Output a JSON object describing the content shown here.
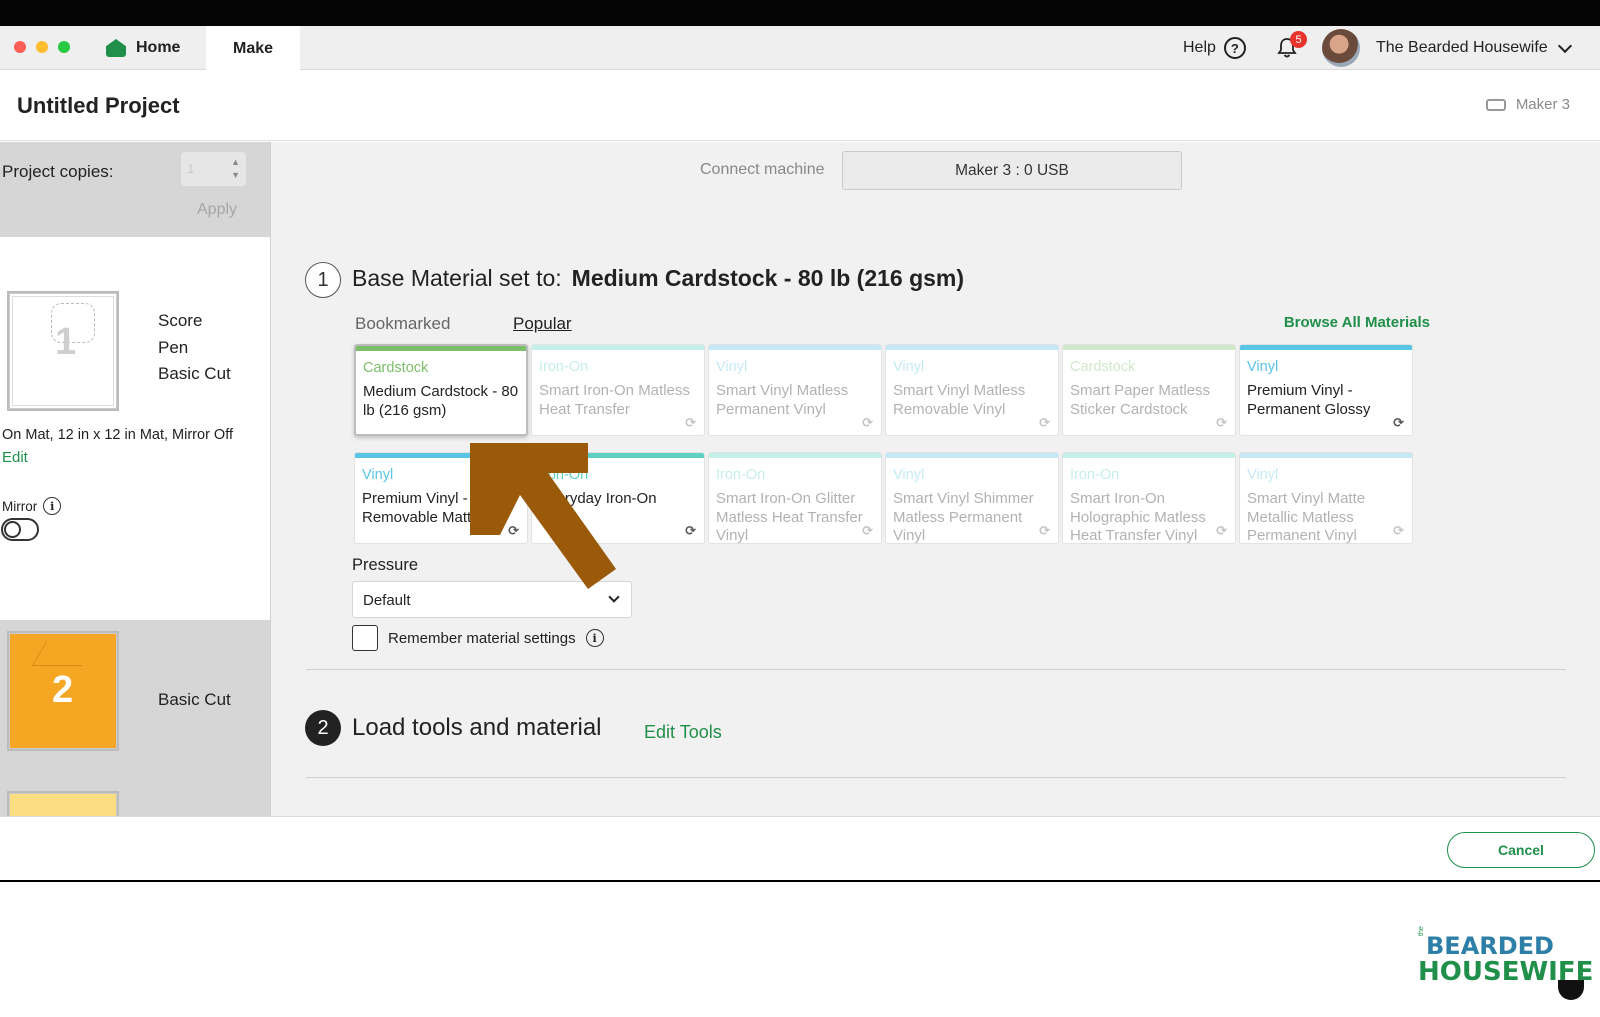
{
  "titlebar": {
    "home_label": "Home",
    "make_label": "Make",
    "help_label": "Help",
    "help_icon": "?",
    "notification_count": "5",
    "user_name": "The Bearded Housewife"
  },
  "project": {
    "title": "Untitled Project",
    "machine": "Maker 3"
  },
  "sidebar": {
    "copies_label": "Project copies:",
    "copies_value": "1",
    "apply_label": "Apply",
    "mat1": {
      "number": "1",
      "operations": [
        "Score",
        "Pen",
        "Basic Cut"
      ],
      "settings": "On Mat, 12 in x 12 in Mat, Mirror Off",
      "edit_label": "Edit",
      "mirror_label": "Mirror"
    },
    "mat2": {
      "number": "2",
      "operation": "Basic Cut"
    }
  },
  "connect": {
    "label": "Connect machine",
    "button": "Maker 3 : 0 USB"
  },
  "step1": {
    "number": "1",
    "prefix": "Base Material set to:",
    "material": "Medium Cardstock - 80 lb (216 gsm)",
    "tabs": [
      "Bookmarked",
      "Popular"
    ],
    "browse_label": "Browse All Materials",
    "cards": [
      {
        "category": "Cardstock",
        "name": "Medium Cardstock - 80 lb (216 gsm)",
        "color": "#7cbf6a",
        "faded": false,
        "selected": true
      },
      {
        "category": "Iron-On",
        "name": "Smart Iron-On Matless Heat Transfer",
        "color": "#5fd1c4",
        "faded": true
      },
      {
        "category": "Vinyl",
        "name": "Smart Vinyl Matless Permanent Vinyl",
        "color": "#58c4e6",
        "faded": true
      },
      {
        "category": "Vinyl",
        "name": "Smart Vinyl Matless Removable Vinyl",
        "color": "#58c4e6",
        "faded": true
      },
      {
        "category": "Cardstock",
        "name": "Smart Paper Matless Sticker Cardstock",
        "color": "#7cbf6a",
        "faded": true
      },
      {
        "category": "Vinyl",
        "name": "Premium Vinyl - Permanent Glossy",
        "color": "#58c4e6",
        "faded": false
      },
      {
        "category": "Vinyl",
        "name": "Premium Vinyl - Removable Matte",
        "color": "#58c4e6",
        "faded": false
      },
      {
        "category": "Iron-On",
        "name": "Everyday Iron-On",
        "color": "#5fd1c4",
        "faded": false
      },
      {
        "category": "Iron-On",
        "name": "Smart Iron-On Glitter Matless Heat Transfer Vinyl",
        "color": "#5fd1c4",
        "faded": true
      },
      {
        "category": "Vinyl",
        "name": "Smart Vinyl Shimmer Matless Permanent Vinyl",
        "color": "#58c4e6",
        "faded": true
      },
      {
        "category": "Iron-On",
        "name": "Smart Iron-On Holographic Matless Heat Transfer Vinyl",
        "color": "#5fd1c4",
        "faded": true
      },
      {
        "category": "Vinyl",
        "name": "Smart Vinyl Matte Metallic Matless Permanent Vinyl",
        "color": "#58c4e6",
        "faded": true
      }
    ],
    "pressure_label": "Pressure",
    "pressure_value": "Default",
    "remember_label": "Remember material settings"
  },
  "step2": {
    "number": "2",
    "title": "Load tools and material",
    "edit_tools_label": "Edit Tools"
  },
  "footer": {
    "cancel_label": "Cancel"
  },
  "watermark": {
    "small": "the",
    "line1": "BEARDED",
    "line2": "HOUSEWIFE"
  },
  "colors": {
    "accent_green": "#1f8f4a",
    "arrow_brown": "#9a5a0a",
    "mat2_orange": "#f5a623"
  }
}
